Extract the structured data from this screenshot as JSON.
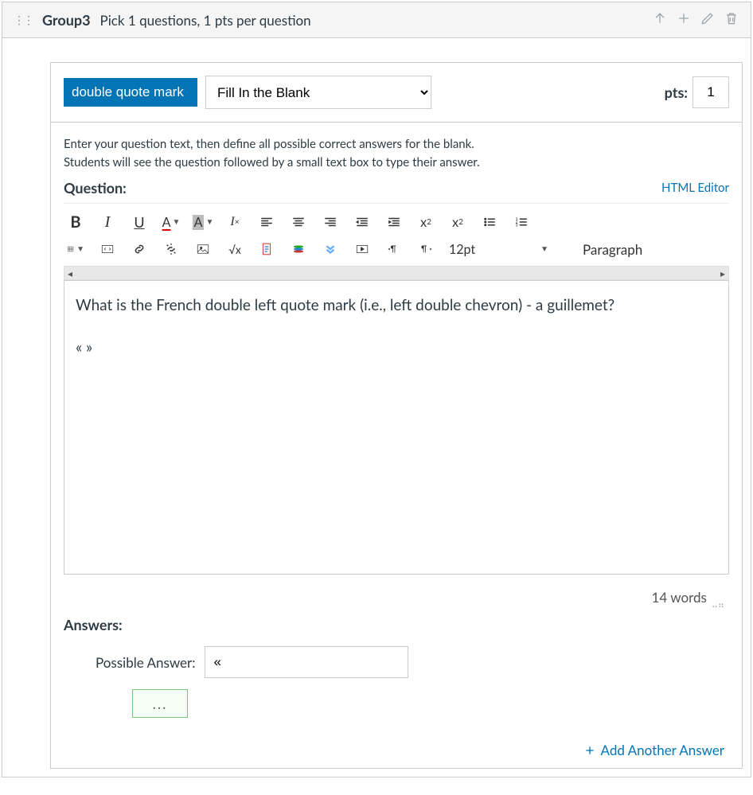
{
  "group": {
    "title": "Group3",
    "subtitle": "Pick 1 questions, 1 pts per question"
  },
  "question": {
    "name": "double quote mark",
    "type": "Fill In the Blank",
    "pts_label": "pts:",
    "pts_value": "1",
    "instructions_line1": "Enter your question text, then define all possible correct answers for the blank.",
    "instructions_line2": "Students will see the question followed by a small text box to type their answer.",
    "label": "Question:",
    "html_editor_link": "HTML Editor",
    "body_line1": "What is the French double left quote mark (i.e., left double chevron) - a guillemet?",
    "body_line2": "«  »",
    "word_count": "14 words"
  },
  "toolbar": {
    "font_size": "12pt",
    "paragraph": "Paragraph"
  },
  "answers": {
    "label": "Answers:",
    "possible_label": "Possible Answer:",
    "value": "«",
    "dots": "...",
    "add_link": "Add Another Answer"
  },
  "icons": {
    "bold": "B",
    "italic": "I",
    "underline": "U",
    "textcolor": "A",
    "bgcolor": "A",
    "sqrt": "√x"
  }
}
